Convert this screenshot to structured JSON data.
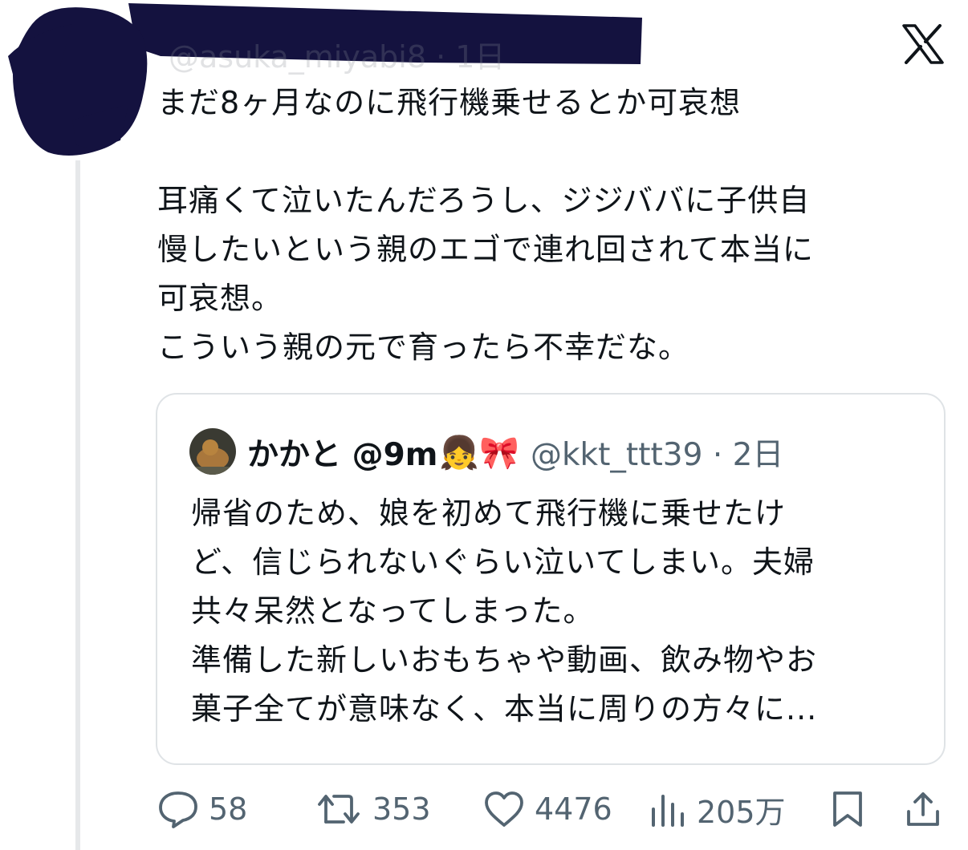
{
  "header": {
    "handle_line": "@asuka_miyabi8 · 1日"
  },
  "tweet": {
    "lines_p1": [
      "まだ8ヶ月なのに飛行機乗せるとか可哀想"
    ],
    "lines_p2": [
      "耳痛くて泣いたんだろうし、ジジババに子供自",
      "慢したいという親のエゴで連れ回されて本当に",
      "可哀想。",
      "こういう親の元で育ったら不幸だな。"
    ]
  },
  "quote": {
    "name": "かかと @9m",
    "emoji": "👧🎀",
    "handle": "@kkt_ttt39 · 2日",
    "lines": [
      "帰省のため、娘を初めて飛行機に乗せたけ",
      "ど、信じられないぐらい泣いてしまい。夫婦",
      "共々呆然となってしまった。",
      "準備した新しいおもちゃや動画、飲み物やお",
      "菓子全てが意味なく、本当に周りの方々に..."
    ]
  },
  "actions": {
    "replies": "58",
    "retweets": "353",
    "likes": "4476",
    "views": "205万"
  },
  "icons": [
    "x-logo-icon",
    "reply-icon",
    "retweet-icon",
    "like-icon",
    "views-icon",
    "bookmark-icon",
    "share-icon"
  ],
  "colors": {
    "text": "#0f1419",
    "muted": "#536471",
    "redaction": "#14123f",
    "border": "#dfe3e6"
  }
}
